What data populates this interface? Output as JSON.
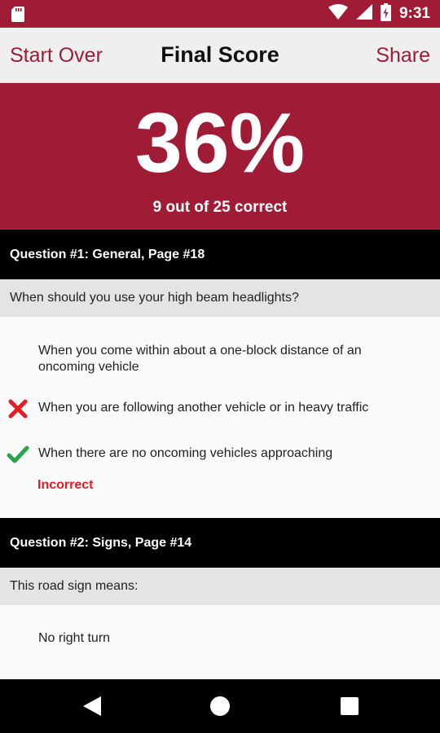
{
  "status_bar": {
    "time": "9:31"
  },
  "toolbar": {
    "start_over": "Start Over",
    "title": "Final Score",
    "share": "Share"
  },
  "score": {
    "percent": "36%",
    "summary": "9 out of 25 correct"
  },
  "questions": [
    {
      "header": "Question #1: General, Page #18",
      "text": "When should you use your high beam headlights?",
      "answers": [
        {
          "text": "When you come within about a one-block distance of an oncoming vehicle",
          "mark": ""
        },
        {
          "text": "When you are following another vehicle or in heavy traffic",
          "mark": "wrong"
        },
        {
          "text": "When there are no oncoming vehicles approaching",
          "mark": "correct"
        }
      ],
      "result": "Incorrect"
    },
    {
      "header": "Question #2: Signs, Page #14",
      "text": "This road sign means:",
      "answers": [
        {
          "text": "No right turn",
          "mark": ""
        }
      ]
    }
  ],
  "colors": {
    "brand": "#a01b36",
    "wrong": "#e41c23",
    "correct": "#2aa54b"
  },
  "icons": [
    "sd-card-icon",
    "wifi-icon",
    "cell-signal-icon",
    "battery-charging-icon",
    "wrong-x-icon",
    "correct-check-icon",
    "back-triangle-icon",
    "home-circle-icon",
    "recents-square-icon"
  ]
}
